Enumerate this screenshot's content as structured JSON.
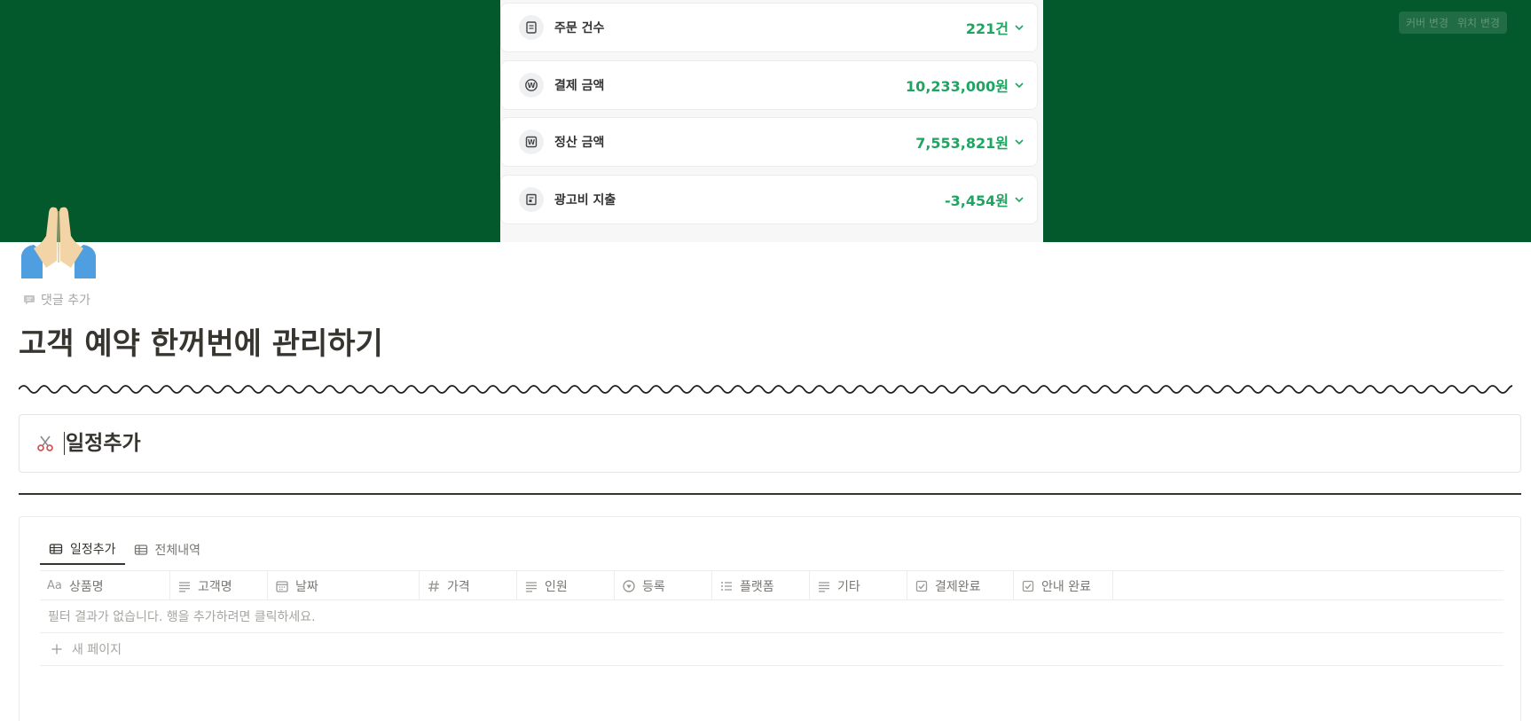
{
  "cover": {
    "background_color": "#03582c",
    "stats": [
      {
        "icon": "receipt-icon",
        "label": "주문 건수",
        "value": "221건"
      },
      {
        "icon": "won-circle-icon",
        "label": "결제 금액",
        "value": "10,233,000원"
      },
      {
        "icon": "won-square-icon",
        "label": "정산 금액",
        "value": "7,553,821원"
      },
      {
        "icon": "ad-document-icon",
        "label": "광고비 지출",
        "value": "-3,454원"
      }
    ],
    "value_color": "#1fa462",
    "change_cover_label": "커버 변경",
    "reposition_label": "위치 변경"
  },
  "page": {
    "icon": "folded-hands-emoji",
    "add_comment_label": "댓글 추가",
    "title": "고객 예약 한꺼번에 관리하기"
  },
  "callout": {
    "icon": "scissors-icon",
    "text": "일정추가"
  },
  "database": {
    "tabs": [
      {
        "label": "일정추가",
        "icon": "table-icon",
        "active": true
      },
      {
        "label": "전체내역",
        "icon": "table-icon",
        "active": false
      }
    ],
    "columns": [
      {
        "label": "상품명",
        "icon": "title-aa-icon"
      },
      {
        "label": "고객명",
        "icon": "text-lines-icon"
      },
      {
        "label": "날짜",
        "icon": "calendar-icon"
      },
      {
        "label": "가격",
        "icon": "hash-icon"
      },
      {
        "label": "인원",
        "icon": "text-lines-icon"
      },
      {
        "label": "등록",
        "icon": "status-icon"
      },
      {
        "label": "플랫폼",
        "icon": "multi-select-icon"
      },
      {
        "label": "기타",
        "icon": "text-lines-icon"
      },
      {
        "label": "결제완료",
        "icon": "checkbox-icon"
      },
      {
        "label": "안내 완료",
        "icon": "checkbox-icon"
      }
    ],
    "empty_text": "필터 결과가 없습니다. 행을 추가하려면 클릭하세요.",
    "new_page_label": "새 페이지"
  }
}
